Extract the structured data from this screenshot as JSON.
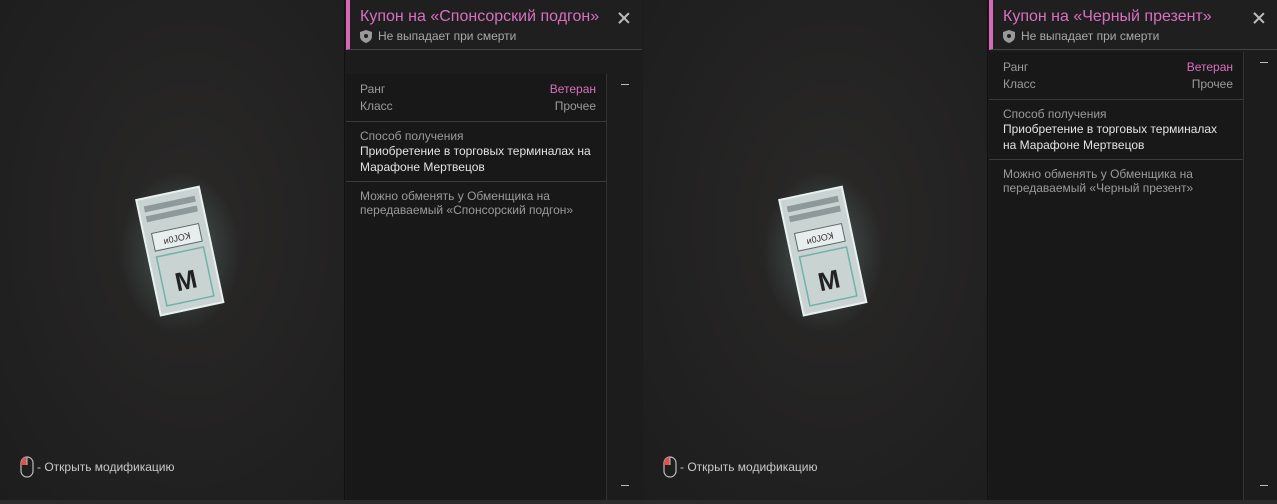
{
  "cards": [
    {
      "title": "Купон на «Спонсорский подгон»",
      "no_drop": "Не выпадает при смерти",
      "rank_label": "Ранг",
      "rank_value": "Ветеран",
      "class_label": "Класс",
      "class_value": "Прочее",
      "obtain_label": "Способ получения",
      "obtain_value": "Приобретение в торговых терминалах на Марафоне Мертвецов",
      "note": "Можно обменять у Обменщика на передаваемый «Спонсорский подгон»",
      "open_mod": "- Открыть модификацию"
    },
    {
      "title": "Купон на «Черный презент»",
      "no_drop": "Не выпадает при смерти",
      "rank_label": "Ранг",
      "rank_value": "Ветеран",
      "class_label": "Класс",
      "class_value": "Прочее",
      "obtain_label": "Способ получения",
      "obtain_value": "Приобретение в торговых терминалах на Марафоне Мертвецов",
      "note": "Можно обменять у Обменщика на передаваемый «Черный презент»",
      "open_mod": "- Открыть модификацию"
    }
  ],
  "colors": {
    "accent": "#d96fbf",
    "accent_bar": "#d569b5"
  }
}
